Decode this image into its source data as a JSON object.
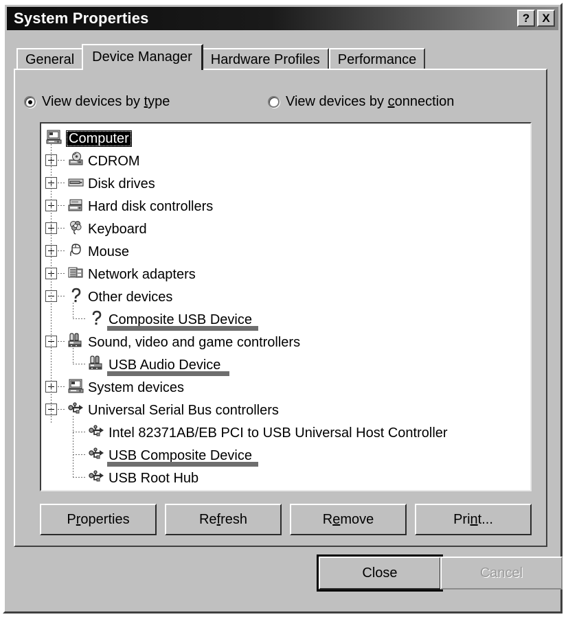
{
  "window": {
    "title": "System Properties",
    "help_button": "?",
    "close_button": "X"
  },
  "tabs": [
    {
      "label": "General",
      "active": false
    },
    {
      "label": "Device Manager",
      "active": true
    },
    {
      "label": "Hardware Profiles",
      "active": false
    },
    {
      "label": "Performance",
      "active": false
    }
  ],
  "view_options": [
    {
      "label_pre": "View devices by ",
      "accel": "t",
      "label_post": "ype",
      "selected": true
    },
    {
      "label_pre": "View devices by ",
      "accel": "c",
      "label_post": "onnection",
      "selected": false
    }
  ],
  "device_tree": [
    {
      "label": "Computer",
      "level": 0,
      "icon": "computer-icon",
      "expander": "none",
      "selected": true,
      "highlighted": false
    },
    {
      "label": "CDROM",
      "level": 1,
      "icon": "cdrom-icon",
      "expander": "plus",
      "selected": false,
      "highlighted": false
    },
    {
      "label": "Disk drives",
      "level": 1,
      "icon": "disk-icon",
      "expander": "plus",
      "selected": false,
      "highlighted": false
    },
    {
      "label": "Hard disk controllers",
      "level": 1,
      "icon": "hdc-icon",
      "expander": "plus",
      "selected": false,
      "highlighted": false
    },
    {
      "label": "Keyboard",
      "level": 1,
      "icon": "keyboard-icon",
      "expander": "plus",
      "selected": false,
      "highlighted": false
    },
    {
      "label": "Mouse",
      "level": 1,
      "icon": "mouse-icon",
      "expander": "plus",
      "selected": false,
      "highlighted": false
    },
    {
      "label": "Network adapters",
      "level": 1,
      "icon": "network-icon",
      "expander": "plus",
      "selected": false,
      "highlighted": false
    },
    {
      "label": "Other devices",
      "level": 1,
      "icon": "question-icon",
      "expander": "minus",
      "selected": false,
      "highlighted": false
    },
    {
      "label": "Composite USB Device",
      "level": 2,
      "icon": "question-icon",
      "expander": "none",
      "selected": false,
      "highlighted": true
    },
    {
      "label": "Sound, video and game controllers",
      "level": 1,
      "icon": "sound-icon",
      "expander": "minus",
      "selected": false,
      "highlighted": false
    },
    {
      "label": "USB Audio Device",
      "level": 2,
      "icon": "sound-icon",
      "expander": "none",
      "selected": false,
      "highlighted": true
    },
    {
      "label": "System devices",
      "level": 1,
      "icon": "computer-icon",
      "expander": "plus",
      "selected": false,
      "highlighted": false
    },
    {
      "label": "Universal Serial Bus controllers",
      "level": 1,
      "icon": "usb-icon",
      "expander": "minus",
      "selected": false,
      "highlighted": false
    },
    {
      "label": "Intel 82371AB/EB PCI to USB Universal Host Controller",
      "level": 2,
      "icon": "usb-icon",
      "expander": "none",
      "selected": false,
      "highlighted": false
    },
    {
      "label": "USB Composite Device",
      "level": 2,
      "icon": "usb-icon",
      "expander": "none",
      "selected": false,
      "highlighted": true
    },
    {
      "label": "USB Root Hub",
      "level": 2,
      "icon": "usb-icon",
      "expander": "none",
      "selected": false,
      "highlighted": false
    }
  ],
  "action_buttons": [
    {
      "pre": "P",
      "accel": "r",
      "post": "operties"
    },
    {
      "pre": "Re",
      "accel": "f",
      "post": "resh"
    },
    {
      "pre": "R",
      "accel": "e",
      "post": "move"
    },
    {
      "pre": "Pri",
      "accel": "n",
      "post": "t..."
    }
  ],
  "dialog_buttons": {
    "close": "Close",
    "cancel": "Cancel",
    "close_is_default": true,
    "cancel_is_disabled": true
  },
  "colors": {
    "face": "#c0c0c0",
    "highlight_bar": "#6e6e6e",
    "selection_bg": "#000000",
    "selection_fg": "#ffffff",
    "disabled_text": "#9a9a9a"
  }
}
